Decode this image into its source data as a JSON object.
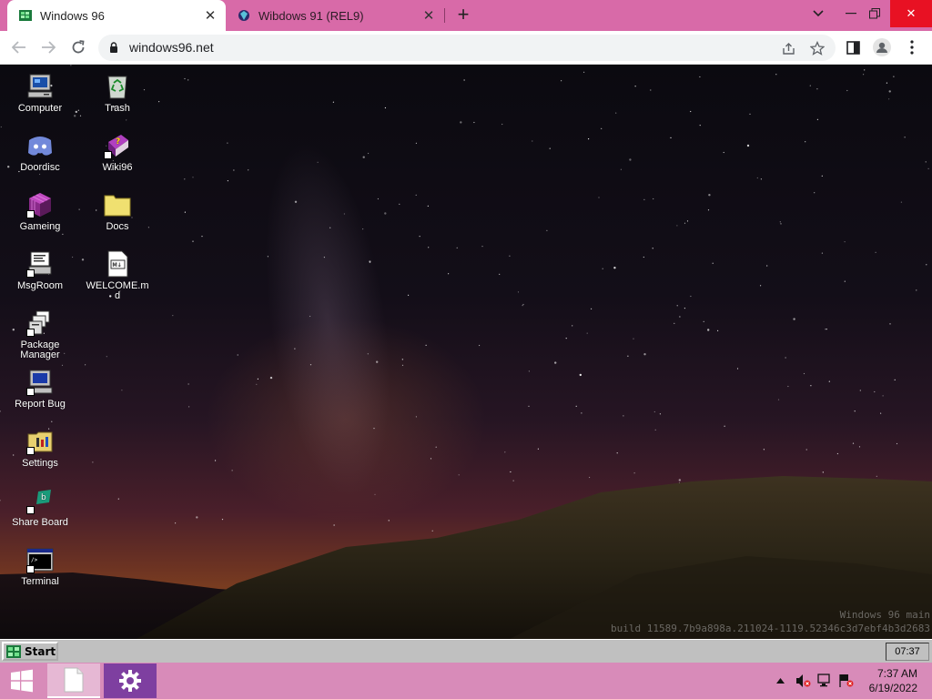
{
  "browser": {
    "tabs": [
      {
        "title": "Windows 96",
        "active": true
      },
      {
        "title": "Wibdows 91 (REL9)",
        "active": false
      }
    ],
    "url": "windows96.net",
    "accent_color": "#d86aa8"
  },
  "desktop": {
    "icons": [
      {
        "label": "Computer",
        "icon": "computer-icon"
      },
      {
        "label": "Doordisc",
        "icon": "discord-icon"
      },
      {
        "label": "Gameing",
        "icon": "cube-icon"
      },
      {
        "label": "MsgRoom",
        "icon": "chat-icon"
      },
      {
        "label": "Package Manager",
        "icon": "package-icon"
      },
      {
        "label": "Report Bug",
        "icon": "bug-report-icon"
      },
      {
        "label": "Settings",
        "icon": "settings-icon"
      },
      {
        "label": "Share Board",
        "icon": "share-icon"
      },
      {
        "label": "Terminal",
        "icon": "terminal-icon"
      },
      {
        "label": "Trash",
        "icon": "recycle-bin-icon"
      },
      {
        "label": "Wiki96",
        "icon": "help-book-icon"
      },
      {
        "label": "Docs",
        "icon": "folder-icon"
      },
      {
        "label": "WELCOME.md",
        "icon": "markdown-file-icon"
      }
    ],
    "watermark_line1": "Windows 96 main",
    "watermark_line2": "build 11589.7b9a898a.211024-1119.52346c3d7ebf4b3d2683"
  },
  "w96_taskbar": {
    "start_label": "Start",
    "clock": "07:37"
  },
  "host_taskbar": {
    "time": "7:37 AM",
    "date": "6/19/2022"
  }
}
